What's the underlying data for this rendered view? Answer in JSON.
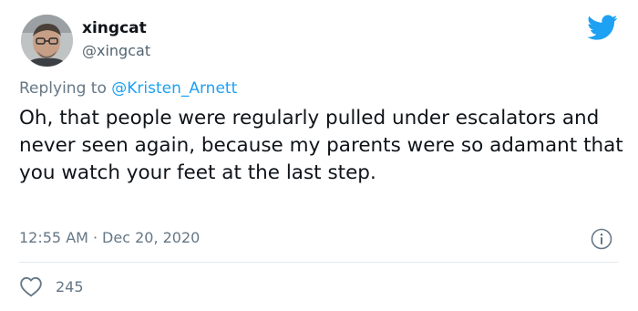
{
  "user": {
    "display_name": "xingcat",
    "handle": "@xingcat",
    "avatar": "avatar"
  },
  "reply": {
    "prefix": "Replying to",
    "to": "@Kristen_Arnett"
  },
  "tweet": {
    "text": "Oh, that people were regularly pulled under escalators and never seen again, because my parents were so adamant that you watch your feet at the last step.",
    "time": "12:55 AM",
    "separator": "·",
    "date": "Dec 20, 2020"
  },
  "actions": {
    "like_count": "245"
  },
  "icons": {
    "logo": "twitter-bird-icon",
    "info": "info-icon",
    "like": "heart-icon"
  },
  "colors": {
    "brand": "#1da1f2",
    "secondary_text": "#657786",
    "primary_text": "#0f1419"
  }
}
